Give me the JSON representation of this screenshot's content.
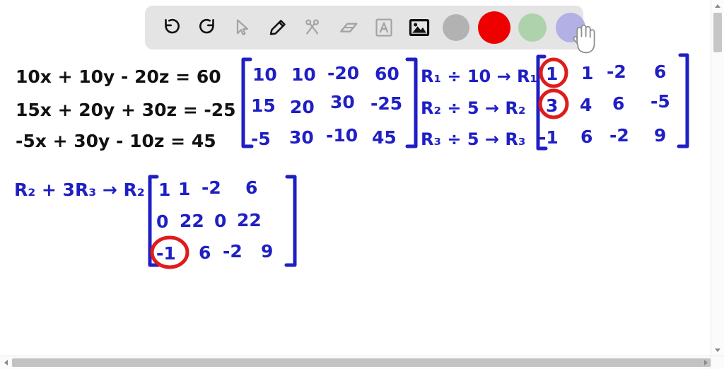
{
  "app": {
    "type": "whiteboard-drawing-canvas",
    "background_color": "#ffffff"
  },
  "toolbar": {
    "background_color": "#e4e4e4",
    "tools": [
      {
        "name": "undo",
        "icon": "undo-icon",
        "label": "Undo",
        "state": "enabled"
      },
      {
        "name": "redo",
        "icon": "redo-icon",
        "label": "Redo",
        "state": "enabled"
      },
      {
        "name": "select",
        "icon": "cursor-arrow-icon",
        "label": "Select",
        "state": "disabled"
      },
      {
        "name": "pen",
        "icon": "pencil-icon",
        "label": "Pen",
        "state": "enabled"
      },
      {
        "name": "cut",
        "icon": "scissors-icon",
        "label": "Cut",
        "state": "disabled"
      },
      {
        "name": "eraser",
        "icon": "eraser-icon",
        "label": "Eraser",
        "state": "disabled"
      },
      {
        "name": "text",
        "icon": "text-a-icon",
        "label": "Text",
        "state": "disabled"
      },
      {
        "name": "image",
        "icon": "image-icon",
        "label": "Insert Image",
        "state": "active"
      }
    ],
    "colors": [
      {
        "name": "gray",
        "hex": "#b2b2b2",
        "selected": false
      },
      {
        "name": "red",
        "hex": "#ee0000",
        "selected": true
      },
      {
        "name": "green",
        "hex": "#aed2ab",
        "selected": false
      },
      {
        "name": "purple",
        "hex": "#b2b0e4",
        "selected": false
      }
    ],
    "cursor": {
      "icon": "hand-pointer-cursor",
      "over": "purple-color-swatch"
    }
  },
  "canvas": {
    "ink_colors": {
      "black": "#111111",
      "blue": "#1f1fc4",
      "red": "#e01b1b"
    },
    "system": {
      "label": "system-of-equations",
      "color": "black",
      "equations": [
        "10x + 10y - 20z = 60",
        "15x + 20y + 30z = -25",
        "-5x + 30y - 10z = 45"
      ]
    },
    "matrix_1": {
      "label": "augmented-matrix-original",
      "color": "blue",
      "rows": [
        [
          "10",
          "10",
          "-20",
          "60"
        ],
        [
          "15",
          "20",
          "30",
          "-25"
        ],
        [
          "-5",
          "30",
          "-10",
          "45"
        ]
      ]
    },
    "row_ops_1": {
      "label": "row-operations-step-1",
      "color": "blue",
      "operations": [
        "R₁ ÷ 10 → R₁",
        "R₂ ÷ 5 → R₂",
        "R₃ ÷ 5 → R₃"
      ]
    },
    "matrix_2": {
      "label": "augmented-matrix-step-1",
      "color": "blue",
      "rows": [
        [
          "1",
          "1",
          "-2",
          "6"
        ],
        [
          "3",
          "4",
          "6",
          "-5"
        ],
        [
          "-1",
          "6",
          "-2",
          "9"
        ]
      ],
      "circled": [
        {
          "row": 0,
          "col": 0,
          "value": "1",
          "color": "red"
        },
        {
          "row": 1,
          "col": 0,
          "value": "3",
          "color": "red"
        }
      ]
    },
    "row_ops_2": {
      "label": "row-operations-step-2",
      "color": "blue",
      "operations": [
        "R₂ + 3R₃ → R₂"
      ]
    },
    "matrix_3": {
      "label": "augmented-matrix-step-2",
      "color": "blue",
      "rows": [
        [
          "1",
          "1",
          "-2",
          "6"
        ],
        [
          "0",
          "22",
          "0",
          "22"
        ],
        [
          "-1",
          "6",
          "-2",
          "9"
        ]
      ],
      "circled": [
        {
          "row": 2,
          "col": 0,
          "value": "-1",
          "color": "red"
        }
      ]
    }
  },
  "scrollbars": {
    "vertical": {
      "position": "right",
      "thumb_fraction": 0.11,
      "at_top": true
    },
    "horizontal": {
      "position": "bottom",
      "thumb_fraction": 0.97
    }
  }
}
